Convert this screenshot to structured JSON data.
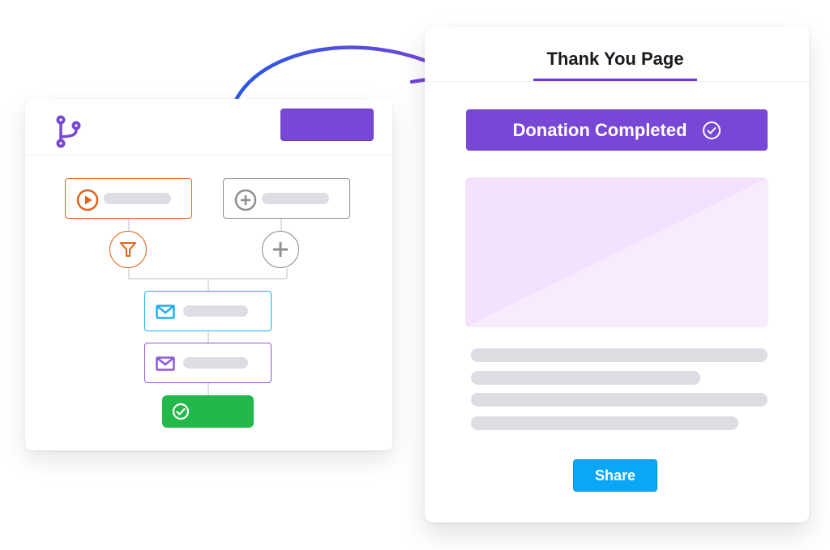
{
  "flow_builder": {
    "header_icon": "branch-icon",
    "header_button_label": "",
    "nodes": [
      {
        "type": "trigger",
        "icon": "play-icon",
        "color": "#e0621a"
      },
      {
        "type": "add-trigger",
        "icon": "plus-circle-icon",
        "color": "#8e8e93"
      },
      {
        "type": "filter",
        "icon": "filter-icon",
        "color": "#e0621a"
      },
      {
        "type": "add-step",
        "icon": "plus-icon",
        "color": "#8e8e93"
      },
      {
        "type": "email",
        "icon": "envelope-icon",
        "color": "#1ab0f5"
      },
      {
        "type": "email",
        "icon": "envelope-icon",
        "color": "#8a58dc"
      },
      {
        "type": "complete",
        "icon": "check-circle-icon",
        "color": "#22b94a"
      }
    ]
  },
  "thank_you_page": {
    "title": "Thank You Page",
    "banner_text": "Donation Completed",
    "banner_icon": "check-circle-icon",
    "share_label": "Share",
    "colors": {
      "accent": "#7847d6",
      "share": "#0aa7f7",
      "image_light": "#f8ebfe",
      "image_dark": "#f3e1fd"
    }
  },
  "connector_arrow": {
    "from": "flow-builder",
    "to": "thank-you-page"
  }
}
